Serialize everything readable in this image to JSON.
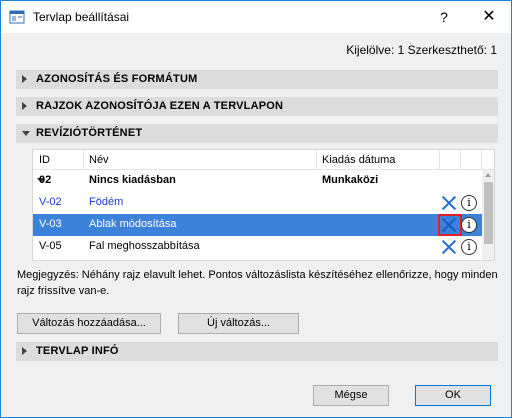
{
  "window": {
    "title": "Tervlap beállításai",
    "help_label": "?",
    "close_label": "✕",
    "icon": "app-window-icon"
  },
  "selection_info": "Kijelölve: 1 Szerkeszthető: 1",
  "sections": {
    "id_format": {
      "label": "AZONOSÍTÁS ÉS FORMÁTUM",
      "expanded": false
    },
    "drawing_ids": {
      "label": "RAJZOK AZONOSÍTÓJA EZEN A TERVLAPON",
      "expanded": false
    },
    "revision_history": {
      "label": "REVÍZIÓTÖRTÉNET",
      "expanded": true
    },
    "sheet_info": {
      "label": "TERVLAP INFÓ",
      "expanded": false
    }
  },
  "revision_table": {
    "headers": {
      "id": "ID",
      "name": "Név",
      "issue_date": "Kiadás dátuma"
    },
    "group": {
      "id": "02",
      "name": "Nincs kiadásban",
      "issue_date": "Munkaközi"
    },
    "rows": [
      {
        "id": "V-02",
        "name": "Födém",
        "selected": false
      },
      {
        "id": "V-03",
        "name": "Ablak módosítása",
        "selected": true
      },
      {
        "id": "V-05",
        "name": "Fal meghosszabbítása",
        "selected": false
      }
    ],
    "info_glyph": "i"
  },
  "note": "Megjegyzés: Néhány rajz elavult lehet. Pontos változáslista készítéséhez ellenőrizze, hogy minden rajz frissítve van-e.",
  "buttons": {
    "add_change": "Változás hozzáadása...",
    "new_change": "Új változás...",
    "cancel": "Mégse",
    "ok": "OK"
  },
  "colors": {
    "accent": "#3c82d8",
    "link": "#1d3bd6",
    "highlight": "#e2202a",
    "section_bar": "#dcdcdc"
  }
}
